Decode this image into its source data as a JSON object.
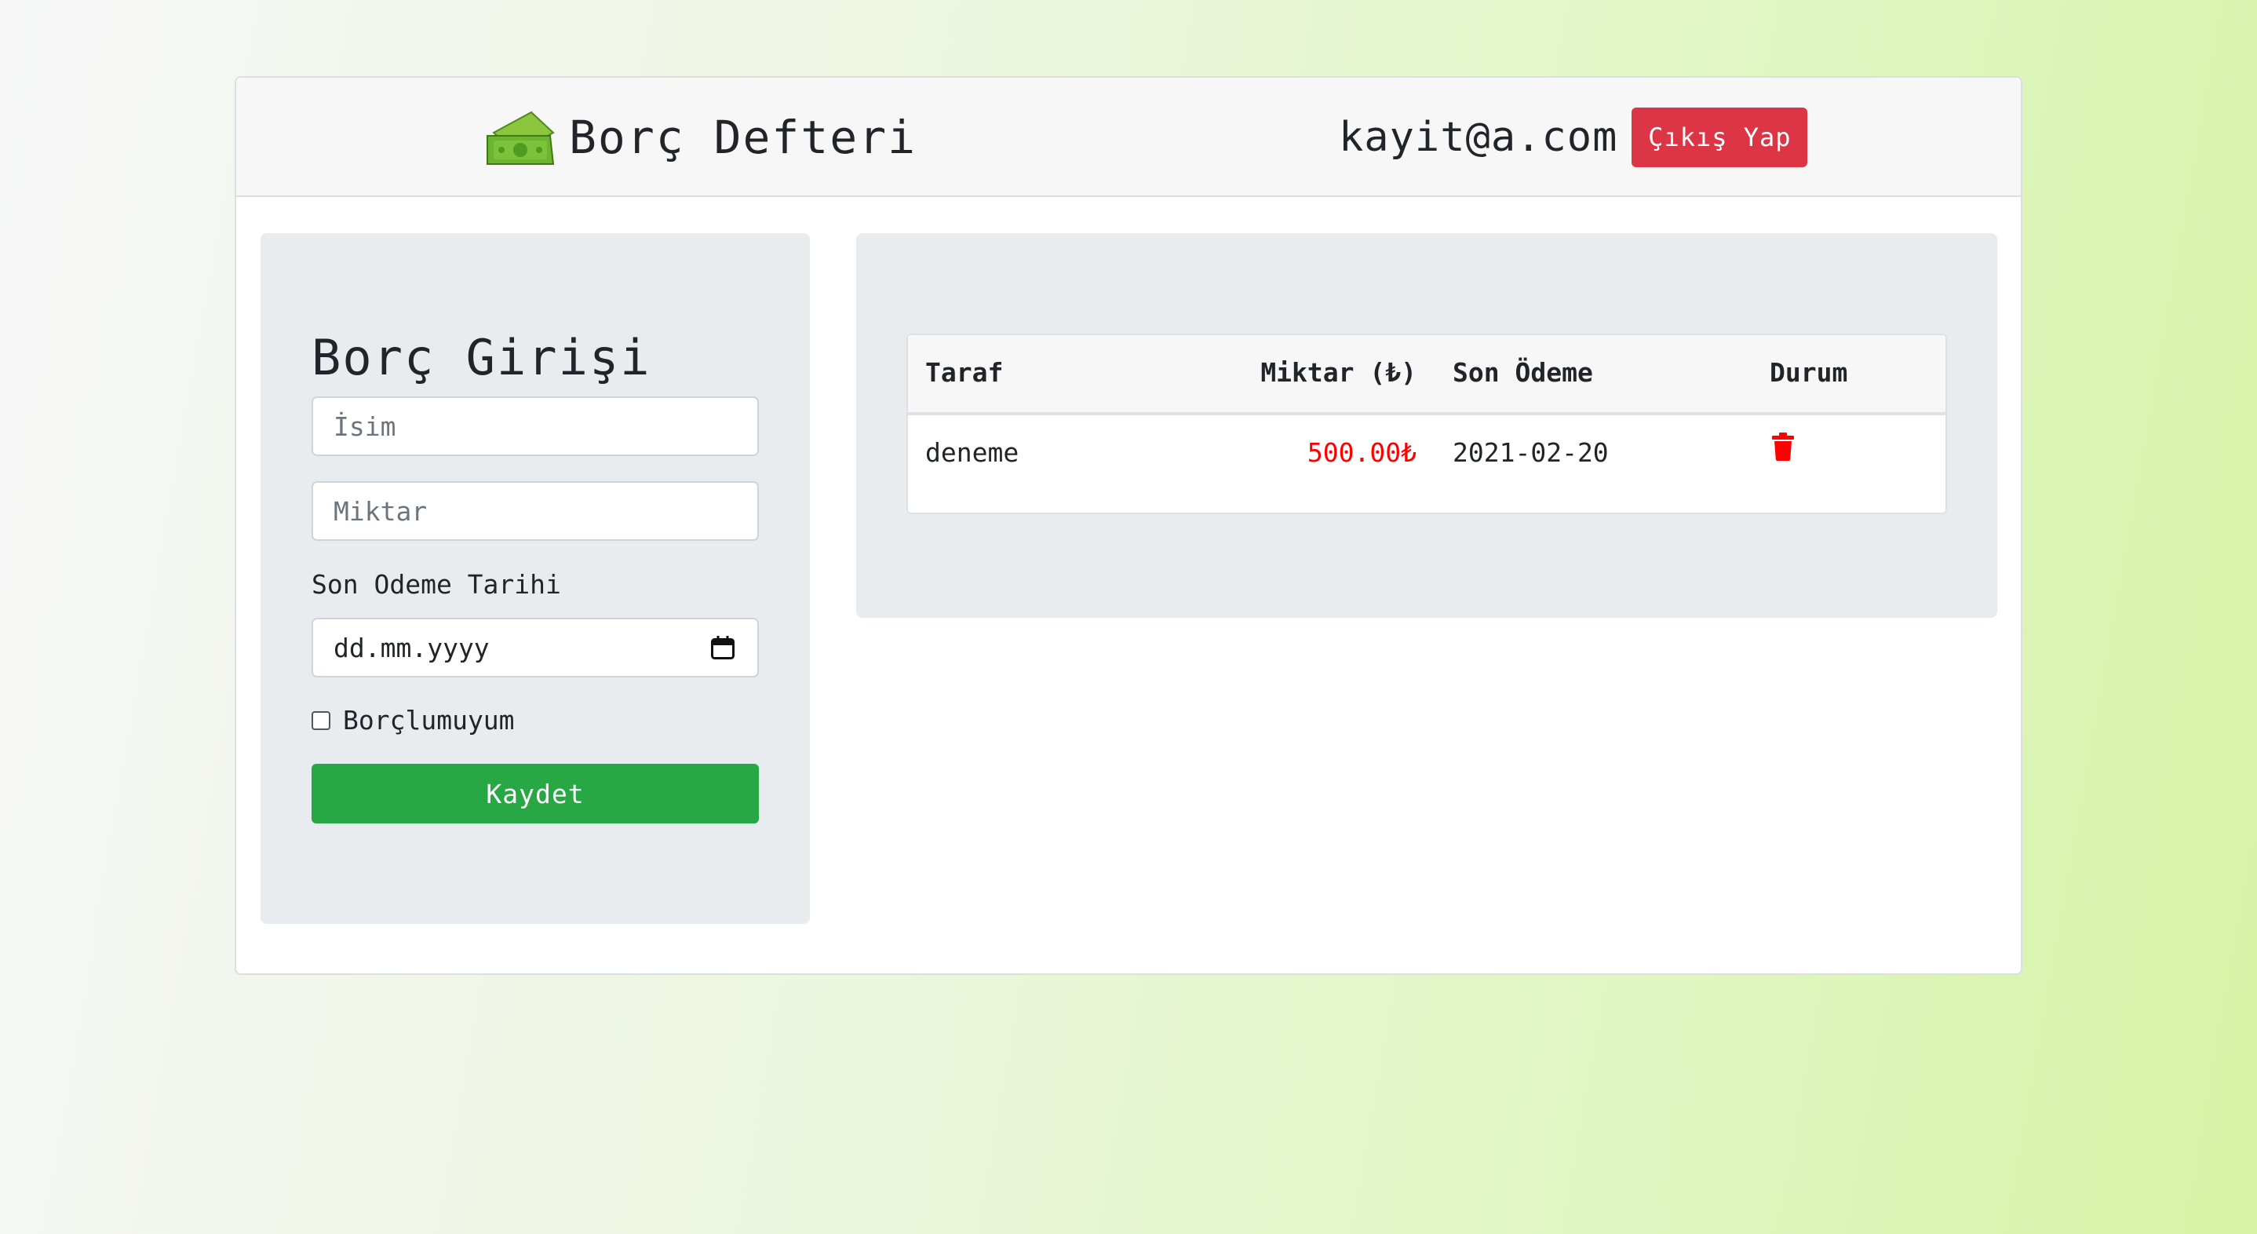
{
  "header": {
    "brand_icon": "money-bill-icon",
    "title": "Borç Defteri",
    "user_email": "kayit@a.com",
    "logout_label": "Çıkış Yap"
  },
  "form": {
    "title": "Borç Girişi",
    "name_placeholder": "İsim",
    "amount_placeholder": "Miktar",
    "date_label": "Son Odeme Tarihi",
    "date_placeholder": "dd.mm.yyyy",
    "debtor_checkbox_label": "Borçlumuyum",
    "debtor_checked": false,
    "save_label": "Kaydet"
  },
  "table": {
    "columns": [
      "Taraf",
      "Miktar (₺)",
      "Son Ödeme",
      "Durum"
    ],
    "rows": [
      {
        "taraf": "deneme",
        "miktar": "500.00₺",
        "son_odeme": "2021-02-20",
        "durum_icon": "trash-icon"
      }
    ]
  },
  "colors": {
    "danger": "#dc3545",
    "success": "#28a745",
    "amount_red": "#ff0000",
    "panel_bg": "#e9ecef"
  }
}
